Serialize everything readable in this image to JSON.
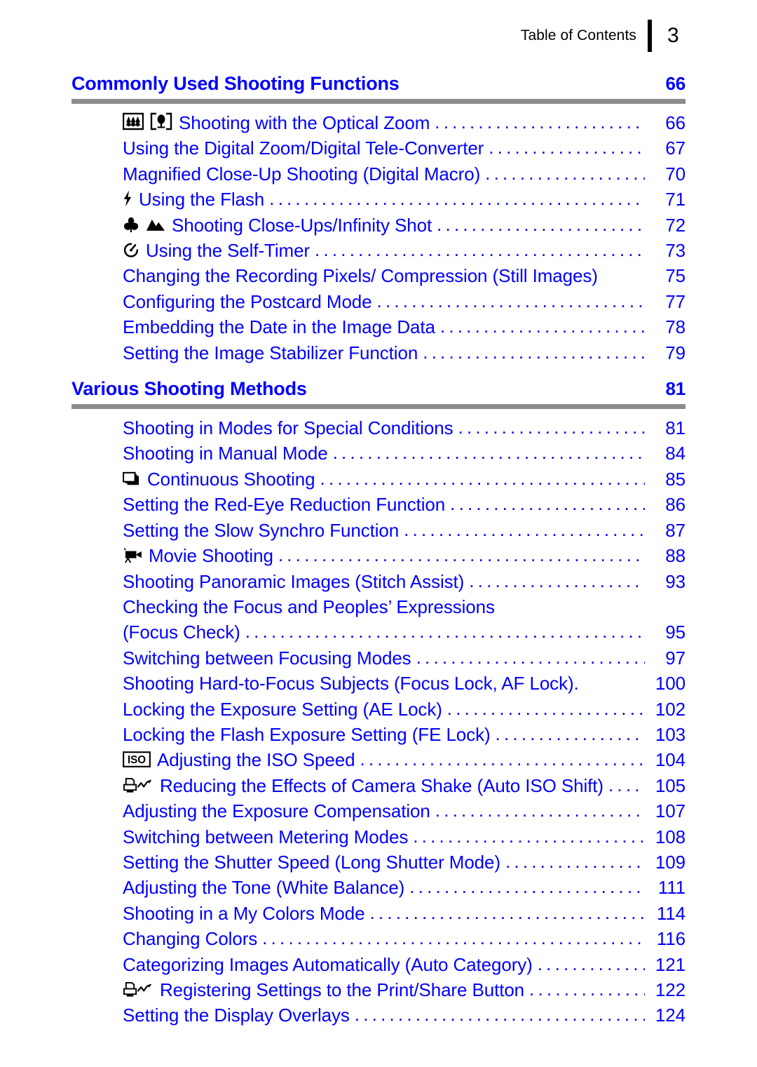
{
  "header": {
    "title": "Table of Contents",
    "page_number": "3"
  },
  "colors": {
    "accent": "#0000ff",
    "rule": "#8c8c8c",
    "header_text": "#000000"
  },
  "sections": [
    {
      "title": "Commonly Used Shooting Functions",
      "page": "66",
      "entries": [
        {
          "icons": [
            "zoom-wide-icon",
            "zoom-tele-icon"
          ],
          "label": "Shooting with the Optical Zoom",
          "page": "66",
          "leader": true
        },
        {
          "icons": [],
          "label": "Using the Digital Zoom/Digital Tele-Converter",
          "page": "67",
          "leader": true
        },
        {
          "icons": [],
          "label": "Magnified Close-Up Shooting (Digital Macro)",
          "page": "70",
          "leader": true
        },
        {
          "icons": [
            "flash-icon"
          ],
          "label": "Using the Flash",
          "page": "71",
          "leader": true
        },
        {
          "icons": [
            "macro-flower-icon",
            "infinity-mountain-icon"
          ],
          "label": "Shooting Close-Ups/Infinity Shot",
          "page": "72",
          "leader": true
        },
        {
          "icons": [
            "self-timer-icon"
          ],
          "label": "Using the Self-Timer",
          "page": "73",
          "leader": true
        },
        {
          "icons": [],
          "label": "Changing the Recording Pixels/ Compression (Still Images)",
          "page": "75",
          "leader": false
        },
        {
          "icons": [],
          "label": "Configuring the Postcard Mode",
          "page": "77",
          "leader": true
        },
        {
          "icons": [],
          "label": "Embedding the Date in the Image Data",
          "page": "78",
          "leader": true
        },
        {
          "icons": [],
          "label": "Setting the Image Stabilizer Function",
          "page": "79",
          "leader": true
        }
      ]
    },
    {
      "title": "Various Shooting Methods",
      "page": "81",
      "entries": [
        {
          "icons": [],
          "label": "Shooting in Modes for Special Conditions",
          "page": "81",
          "leader": true
        },
        {
          "icons": [],
          "label": "Shooting in Manual Mode",
          "page": "84",
          "leader": true
        },
        {
          "icons": [
            "continuous-shooting-icon"
          ],
          "label": "Continuous Shooting",
          "page": "85",
          "leader": true
        },
        {
          "icons": [],
          "label": "Setting the Red-Eye Reduction Function",
          "page": "86",
          "leader": true
        },
        {
          "icons": [],
          "label": "Setting the Slow Synchro Function",
          "page": "87",
          "leader": true
        },
        {
          "icons": [
            "movie-camera-icon"
          ],
          "label": "Movie Shooting",
          "page": "88",
          "leader": true
        },
        {
          "icons": [],
          "label": "Shooting Panoramic Images (Stitch Assist)",
          "page": "93",
          "leader": true
        },
        {
          "icons": [],
          "label": "Checking the Focus and Peoples’ Expressions",
          "page": "",
          "leader": false,
          "wrap_first": true
        },
        {
          "icons": [],
          "label": "(Focus Check)",
          "page": "95",
          "leader": true
        },
        {
          "icons": [],
          "label": "Switching between Focusing Modes",
          "page": "97",
          "leader": true
        },
        {
          "icons": [],
          "label": "Shooting Hard-to-Focus Subjects (Focus Lock, AF Lock).",
          "page": "100",
          "leader": false
        },
        {
          "icons": [],
          "label": "Locking the Exposure Setting (AE Lock)",
          "page": "102",
          "leader": true
        },
        {
          "icons": [],
          "label": "Locking the Flash Exposure Setting (FE Lock)",
          "page": "103",
          "leader": true
        },
        {
          "icons": [
            "iso-box-icon"
          ],
          "label": "Adjusting the ISO Speed",
          "page": "104",
          "leader": true
        },
        {
          "icons": [
            "print-share-shake-icon"
          ],
          "label": "Reducing the Effects of Camera Shake (Auto ISO Shift)",
          "page": "105",
          "leader": true
        },
        {
          "icons": [],
          "label": "Adjusting the Exposure Compensation",
          "page": "107",
          "leader": true
        },
        {
          "icons": [],
          "label": "Switching between Metering Modes",
          "page": "108",
          "leader": true
        },
        {
          "icons": [],
          "label": "Setting the Shutter Speed (Long Shutter Mode)",
          "page": "109",
          "leader": true
        },
        {
          "icons": [],
          "label": "Adjusting the Tone (White Balance)",
          "page": "111",
          "leader": true
        },
        {
          "icons": [],
          "label": "Shooting in a My Colors Mode",
          "page": "114",
          "leader": true
        },
        {
          "icons": [],
          "label": "Changing Colors",
          "page": "116",
          "leader": true
        },
        {
          "icons": [],
          "label": "Categorizing Images Automatically (Auto Category)",
          "page": "121",
          "leader": true
        },
        {
          "icons": [
            "print-share-shake-icon"
          ],
          "label": "Registering Settings to the Print/Share Button",
          "page": "122",
          "leader": true
        },
        {
          "icons": [],
          "label": "Setting the Display Overlays",
          "page": "124",
          "leader": true
        }
      ]
    }
  ]
}
